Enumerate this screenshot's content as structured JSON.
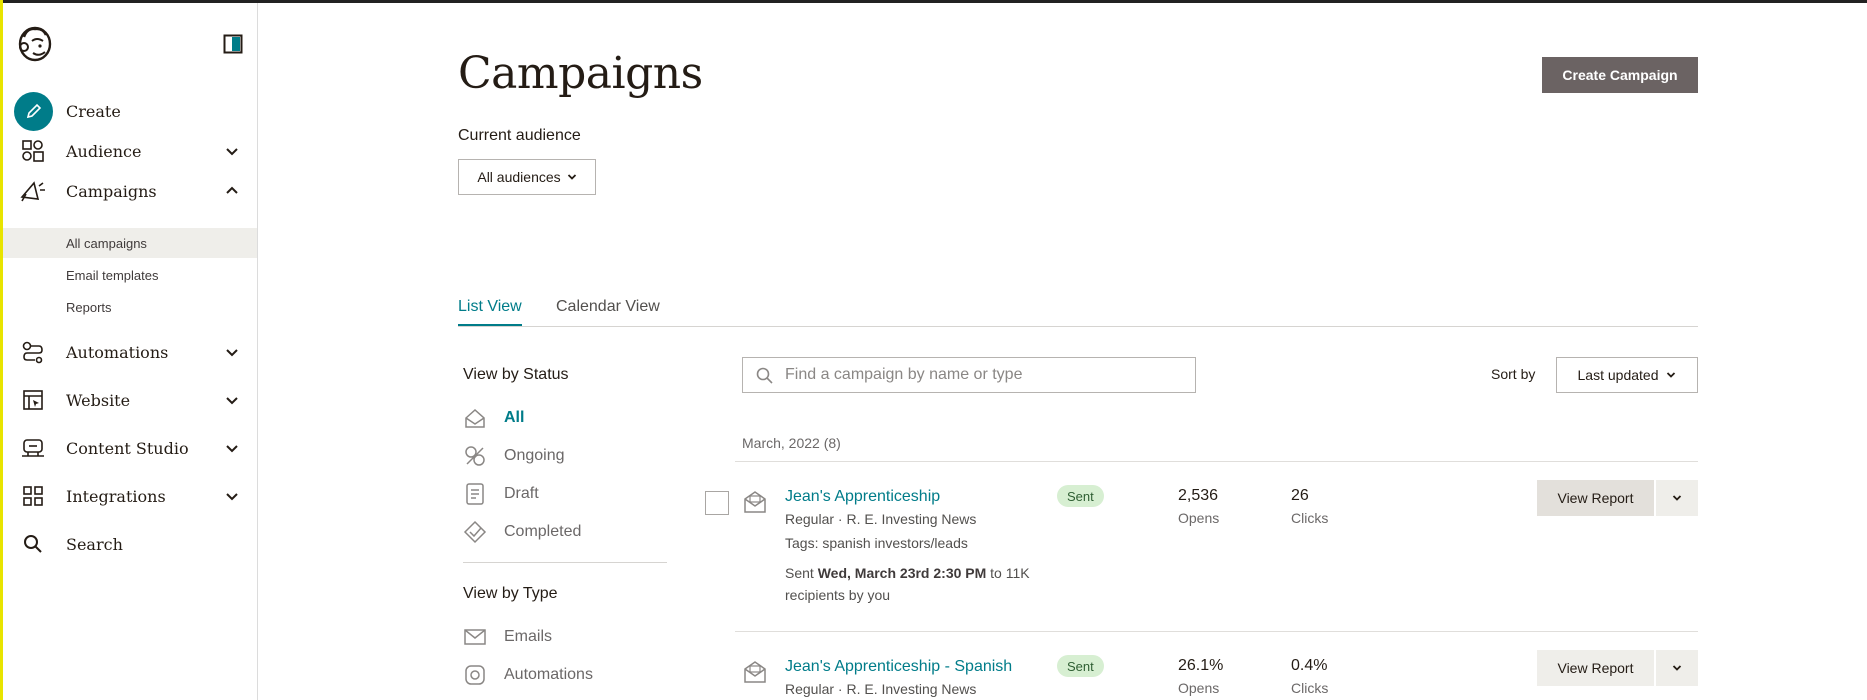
{
  "sidebar": {
    "logo": "mailchimp-freddie-logo",
    "items": [
      {
        "label": "Create",
        "icon": "pencil-icon"
      },
      {
        "label": "Audience",
        "icon": "audience-icon"
      },
      {
        "label": "Campaigns",
        "icon": "megaphone-icon"
      },
      {
        "label": "Automations",
        "icon": "automations-icon"
      },
      {
        "label": "Website",
        "icon": "website-icon"
      },
      {
        "label": "Content Studio",
        "icon": "content-studio-icon"
      },
      {
        "label": "Integrations",
        "icon": "integrations-icon"
      },
      {
        "label": "Search",
        "icon": "search-icon"
      }
    ],
    "campaign_subitems": [
      "All campaigns",
      "Email templates",
      "Reports"
    ]
  },
  "header": {
    "title": "Campaigns",
    "create_button": "Create Campaign",
    "audience_label": "Current audience",
    "audience_value": "All audiences"
  },
  "tabs": [
    "List View",
    "Calendar View"
  ],
  "filters": {
    "status_heading": "View by Status",
    "status": [
      "All",
      "Ongoing",
      "Draft",
      "Completed"
    ],
    "type_heading": "View by Type",
    "types": [
      "Emails",
      "Automations"
    ]
  },
  "list": {
    "search_placeholder": "Find a campaign by name or type",
    "sort_label": "Sort by",
    "sort_value": "Last updated",
    "group_label": "March, 2022 (8)",
    "campaigns": [
      {
        "name": "Jean's Apprenticeship",
        "subtitle": "Regular · R. E. Investing News",
        "tags": "Tags: spanish investors/leads",
        "sent_prefix": "Sent ",
        "sent_date": "Wed, March 23rd 2:30 PM",
        "sent_suffix": " to 11K",
        "sent_line2": "recipients by you",
        "status": "Sent",
        "opens": "2,536",
        "opens_label": "Opens",
        "clicks": "26",
        "clicks_label": "Clicks",
        "action": "View Report"
      },
      {
        "name": "Jean's Apprenticeship - Spanish",
        "subtitle": "Regular · R. E. Investing News",
        "status": "Sent",
        "opens": "26.1%",
        "opens_label": "Opens",
        "clicks": "0.4%",
        "clicks_label": "Clicks",
        "action": "View Report"
      }
    ]
  },
  "colors": {
    "accent": "#007c89",
    "create_button": "#6b6363",
    "sent_badge": "#d7efd2",
    "left_edge": "#e8e400"
  }
}
